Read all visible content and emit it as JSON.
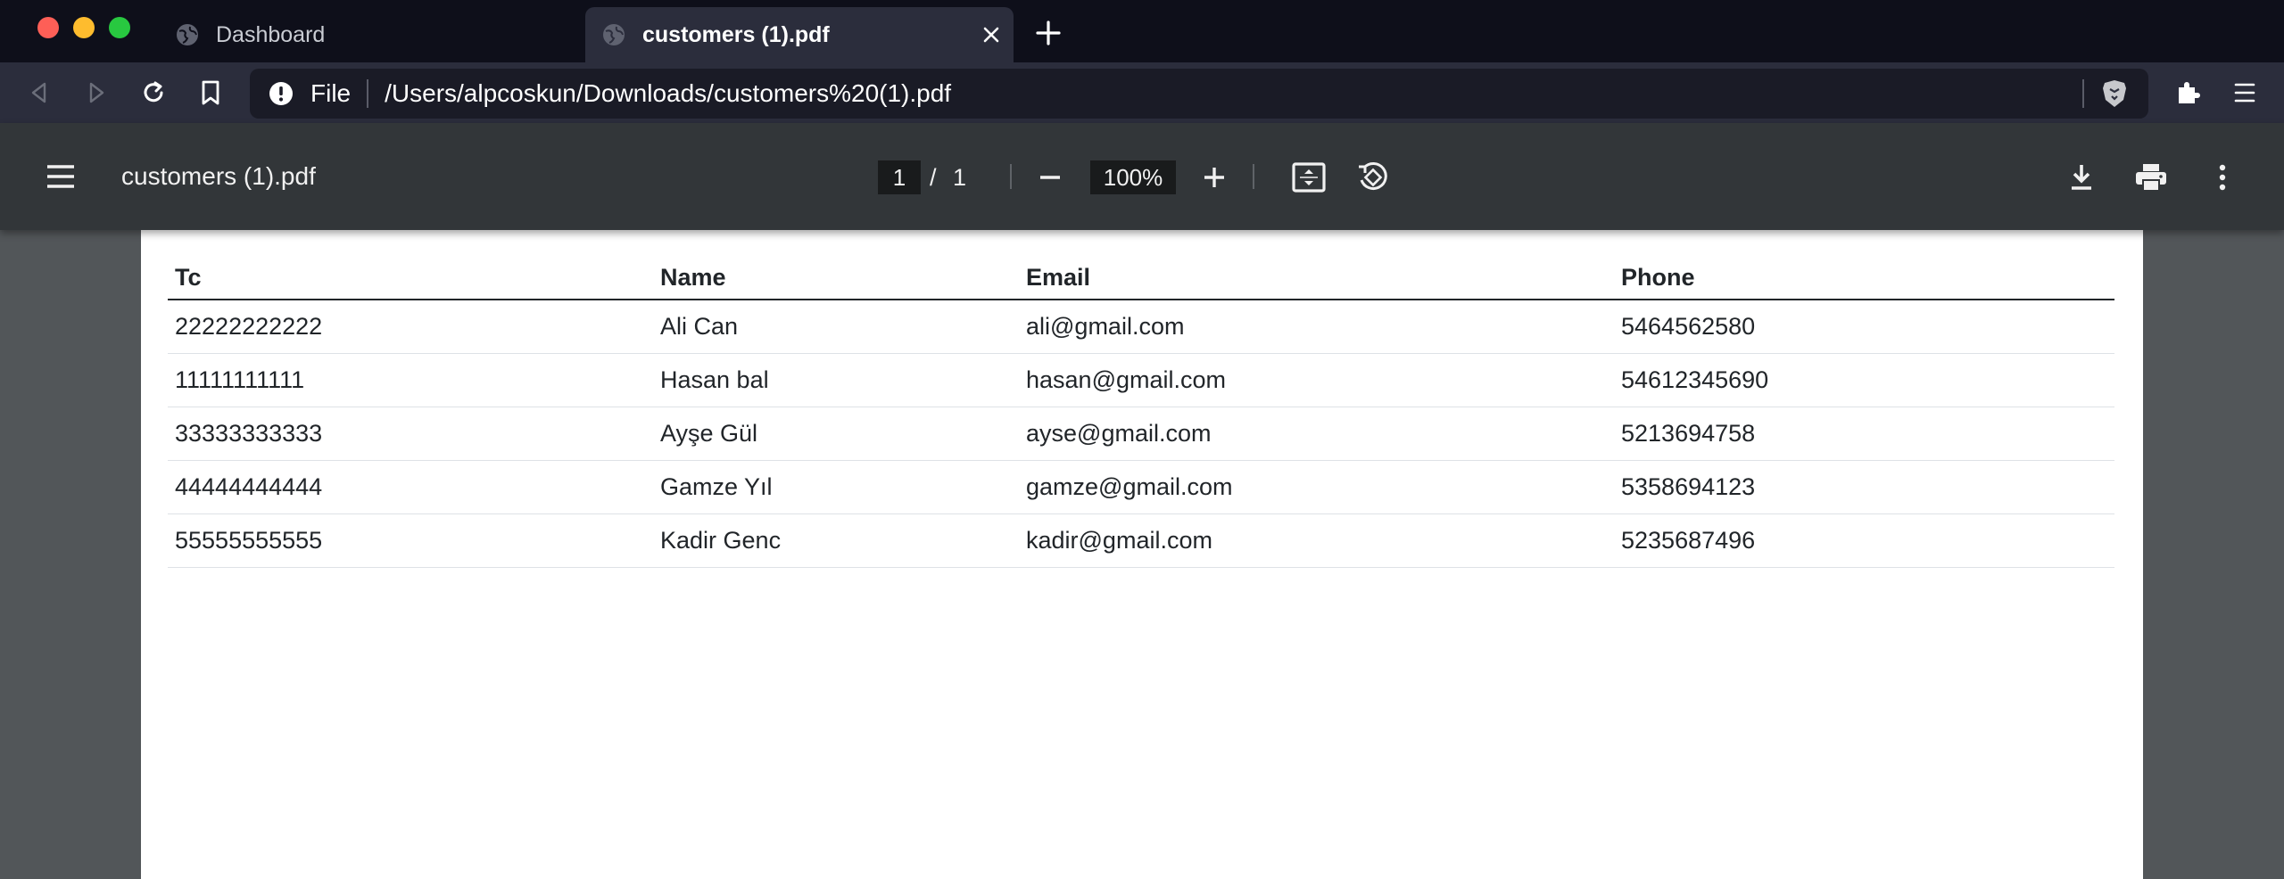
{
  "browser": {
    "tabs": [
      {
        "title": "Dashboard",
        "active": false
      },
      {
        "title": "customers (1).pdf",
        "active": true
      }
    ],
    "omnibox": {
      "scheme_label": "File",
      "url": "/Users/alpcoskun/Downloads/customers%20(1).pdf"
    }
  },
  "pdf_viewer": {
    "title": "customers (1).pdf",
    "current_page": "1",
    "page_separator": "/",
    "total_pages": "1",
    "zoom": "100%"
  },
  "table": {
    "headers": [
      "Tc",
      "Name",
      "Email",
      "Phone"
    ],
    "rows": [
      [
        "22222222222",
        "Ali Can",
        "ali@gmail.com",
        "5464562580"
      ],
      [
        "11111111111",
        "Hasan bal",
        "hasan@gmail.com",
        "54612345690"
      ],
      [
        "33333333333",
        "Ayşe Gül",
        "ayse@gmail.com",
        "5213694758"
      ],
      [
        "44444444444",
        "Gamze Yıl",
        "gamze@gmail.com",
        "5358694123"
      ],
      [
        "55555555555",
        "Kadir Genc",
        "kadir@gmail.com",
        "5235687496"
      ]
    ]
  },
  "colors": {
    "tabstrip": "#0e0f1a",
    "toolbar": "#2b2d3c",
    "pdf_toolbar": "#323639",
    "viewer_background": "#525659"
  },
  "icons": [
    "globe-icon",
    "close-icon",
    "plus-icon",
    "back-icon",
    "forward-icon",
    "reload-icon",
    "bookmark-icon",
    "info-icon",
    "brave-shield-icon",
    "extensions-icon",
    "browser-menu-icon",
    "hamburger-icon",
    "zoom-out-icon",
    "zoom-in-icon",
    "fit-page-icon",
    "rotate-icon",
    "download-icon",
    "print-icon",
    "more-vert-icon"
  ]
}
